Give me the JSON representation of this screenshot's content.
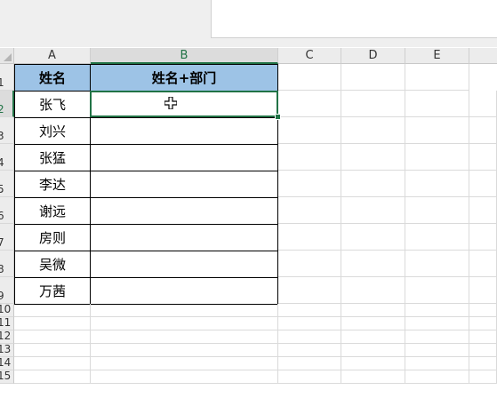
{
  "columns": [
    "A",
    "B",
    "C",
    "D",
    "E"
  ],
  "rows": [
    "1",
    "2",
    "3",
    "4",
    "5",
    "6",
    "7",
    "8",
    "9",
    "10",
    "11",
    "12",
    "13",
    "14",
    "15"
  ],
  "table": {
    "headers": [
      "姓名",
      "姓名+部门"
    ],
    "names": [
      "张飞",
      "刘兴",
      "张猛",
      "李达",
      "谢远",
      "房则",
      "吴微",
      "万茜"
    ]
  },
  "selection": {
    "cell": "B2"
  },
  "colors": {
    "header_fill": "#9dc3e6",
    "selection_border": "#217346"
  }
}
